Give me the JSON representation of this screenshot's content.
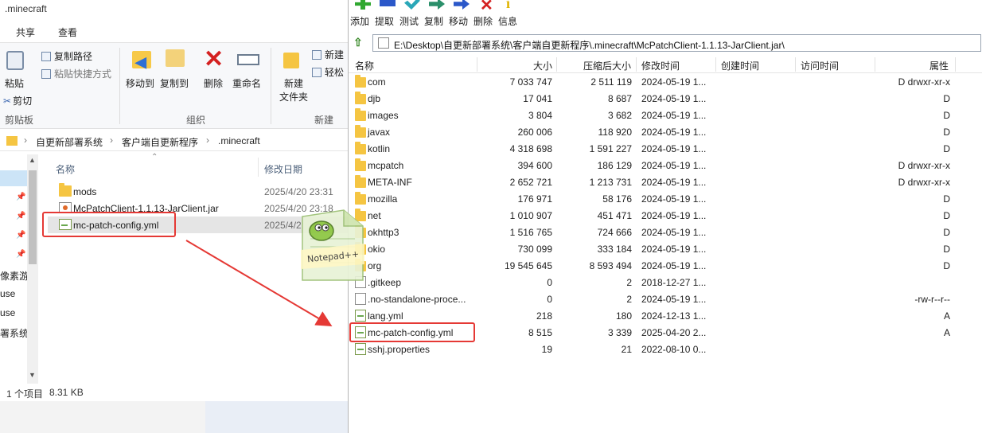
{
  "explorer": {
    "title": ".minecraft",
    "tabs": [
      "共享",
      "查看"
    ],
    "ribbon": {
      "clipboard": {
        "paste": "粘贴",
        "copy_path": "复制路径",
        "paste_shortcut": "粘贴快捷方式",
        "cut": "剪切",
        "group_label": "剪贴板"
      },
      "organize": {
        "move_to": "移动到",
        "copy_to": "复制到",
        "delete": "删除",
        "rename": "重命名",
        "group_label": "组织"
      },
      "new": {
        "new_folder_line1": "新建",
        "new_folder_line2": "文件夹",
        "new_item": "新建",
        "easy_access": "轻松",
        "group_label": "新建"
      }
    },
    "breadcrumb": [
      "自更新部署系统",
      "客户端自更新程序",
      ".minecraft"
    ],
    "nav_items": [
      "像素游",
      "use",
      "use",
      "署系统"
    ],
    "columns": {
      "name": "名称",
      "modified": "修改日期"
    },
    "files": [
      {
        "name": "mods",
        "date": "2025/4/20 23:31",
        "type": "folder"
      },
      {
        "name": "McPatchClient-1.1.13-JarClient.jar",
        "date": "2025/4/20 23:18",
        "type": "jar"
      },
      {
        "name": "mc-patch-config.yml",
        "date": "2025/4/2",
        "type": "yml",
        "selected": true
      }
    ],
    "status": {
      "selected": "1 个项目",
      "size": "8.31 KB"
    }
  },
  "drag_ghost": {
    "label": "Notepad++"
  },
  "sevenzip": {
    "toolbar": [
      {
        "label": "添加",
        "icon": "add-icon",
        "color": "#2fa82f"
      },
      {
        "label": "提取",
        "icon": "extract-icon",
        "color": "#2b58c9"
      },
      {
        "label": "测试",
        "icon": "test-icon",
        "color": "#2aa7b8"
      },
      {
        "label": "复制",
        "icon": "copy-icon",
        "color": "#2a8f6a"
      },
      {
        "label": "移动",
        "icon": "move-icon",
        "color": "#2b58c9"
      },
      {
        "label": "删除",
        "icon": "delete-icon",
        "color": "#d42020"
      },
      {
        "label": "信息",
        "icon": "info-icon",
        "color": "#e0b400"
      }
    ],
    "path": "E:\\Desktop\\自更新部署系统\\客户端自更新程序\\.minecraft\\McPatchClient-1.1.13-JarClient.jar\\",
    "columns": [
      "名称",
      "大小",
      "压缩后大小",
      "修改时间",
      "创建时间",
      "访问时间",
      "属性"
    ],
    "rows": [
      {
        "name": "com",
        "size": "7 033 747",
        "packed": "2 511 119",
        "modified": "2024-05-19 1...",
        "attr": "D drwxr-xr-x",
        "type": "folder"
      },
      {
        "name": "djb",
        "size": "17 041",
        "packed": "8 687",
        "modified": "2024-05-19 1...",
        "attr": "D",
        "type": "folder"
      },
      {
        "name": "images",
        "size": "3 804",
        "packed": "3 682",
        "modified": "2024-05-19 1...",
        "attr": "D",
        "type": "folder"
      },
      {
        "name": "javax",
        "size": "260 006",
        "packed": "118 920",
        "modified": "2024-05-19 1...",
        "attr": "D",
        "type": "folder"
      },
      {
        "name": "kotlin",
        "size": "4 318 698",
        "packed": "1 591 227",
        "modified": "2024-05-19 1...",
        "attr": "D",
        "type": "folder"
      },
      {
        "name": "mcpatch",
        "size": "394 600",
        "packed": "186 129",
        "modified": "2024-05-19 1...",
        "attr": "D drwxr-xr-x",
        "type": "folder"
      },
      {
        "name": "META-INF",
        "size": "2 652 721",
        "packed": "1 213 731",
        "modified": "2024-05-19 1...",
        "attr": "D drwxr-xr-x",
        "type": "folder"
      },
      {
        "name": "mozilla",
        "size": "176 971",
        "packed": "58 176",
        "modified": "2024-05-19 1...",
        "attr": "D",
        "type": "folder"
      },
      {
        "name": "net",
        "size": "1 010 907",
        "packed": "451 471",
        "modified": "2024-05-19 1...",
        "attr": "D",
        "type": "folder"
      },
      {
        "name": "okhttp3",
        "size": "1 516 765",
        "packed": "724 666",
        "modified": "2024-05-19 1...",
        "attr": "D",
        "type": "folder"
      },
      {
        "name": "okio",
        "size": "730 099",
        "packed": "333 184",
        "modified": "2024-05-19 1...",
        "attr": "D",
        "type": "folder"
      },
      {
        "name": "org",
        "size": "19 545 645",
        "packed": "8 593 494",
        "modified": "2024-05-19 1...",
        "attr": "D",
        "type": "folder"
      },
      {
        "name": ".gitkeep",
        "size": "0",
        "packed": "2",
        "modified": "2018-12-27 1...",
        "attr": "",
        "type": "doc"
      },
      {
        "name": ".no-standalone-proce...",
        "size": "0",
        "packed": "2",
        "modified": "2024-05-19 1...",
        "attr": "-rw-r--r--",
        "type": "doc"
      },
      {
        "name": "lang.yml",
        "size": "218",
        "packed": "180",
        "modified": "2024-12-13 1...",
        "attr": "A",
        "type": "yml"
      },
      {
        "name": "mc-patch-config.yml",
        "size": "8 515",
        "packed": "3 339",
        "modified": "2025-04-20 2...",
        "attr": "A",
        "type": "yml"
      },
      {
        "name": "sshj.properties",
        "size": "19",
        "packed": "21",
        "modified": "2022-08-10 0...",
        "attr": "",
        "type": "yml"
      }
    ]
  },
  "colors": {
    "annotation_red": "#e53935",
    "folder_yellow": "#f5c542"
  }
}
